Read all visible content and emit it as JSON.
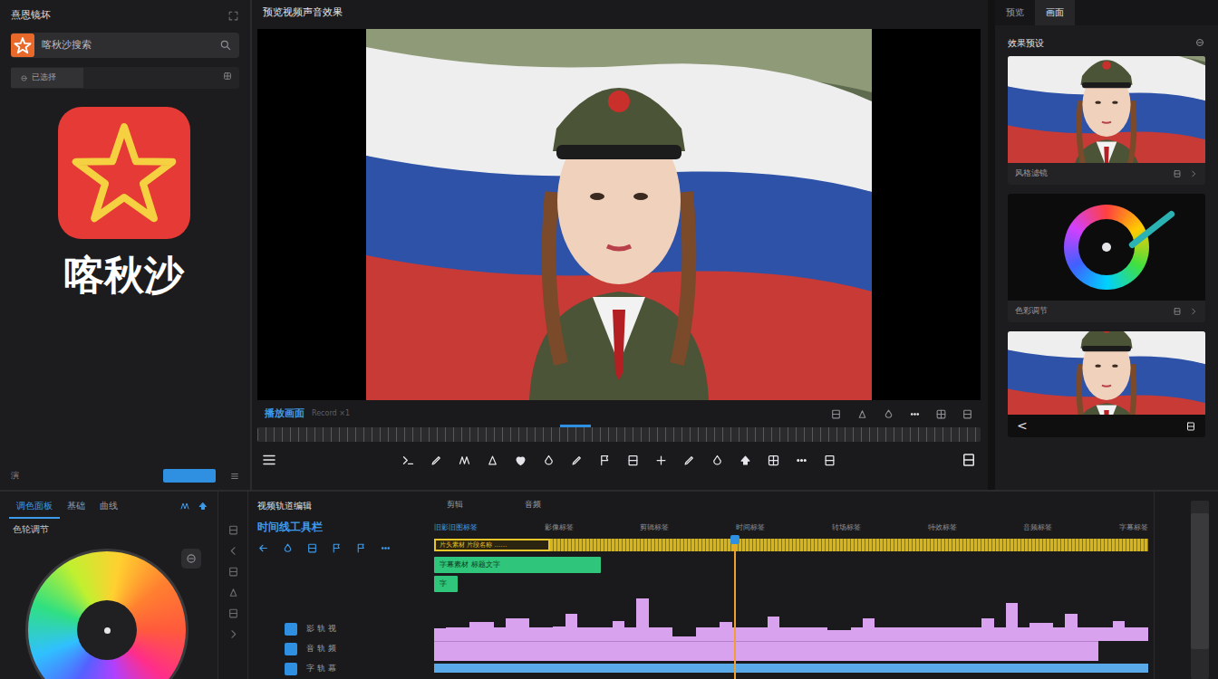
{
  "left_panel": {
    "title": "熹恩镜坏",
    "search": {
      "value": "喀秋沙搜索"
    },
    "filter": {
      "value": "已选择"
    },
    "app": {
      "name": "喀秋沙"
    },
    "footer": {
      "label": "演"
    }
  },
  "preview": {
    "title": "预览视频声音效果",
    "label": "播放画面",
    "timecode": "Record ×1",
    "scrub_level": 0.44
  },
  "right_panel": {
    "tabs": [
      {
        "label": "预览",
        "selected": false
      },
      {
        "label": "画面",
        "selected": true
      }
    ],
    "heading": "效果预设",
    "cards": [
      {
        "kind": "photo",
        "label": "风格滤镜"
      },
      {
        "kind": "wheel",
        "label": "色彩调节"
      },
      {
        "kind": "photo-nav",
        "label": "<"
      }
    ]
  },
  "color_panel": {
    "tabs": [
      {
        "label": "调色面板",
        "selected": true
      },
      {
        "label": "基础",
        "selected": false
      },
      {
        "label": "曲线",
        "selected": false
      }
    ],
    "heading": "色轮调节"
  },
  "timeline": {
    "title": "视频轨道编辑",
    "tabs": [
      {
        "label": "剪辑",
        "selected": false
      },
      {
        "label": "音频",
        "selected": false
      }
    ],
    "toolbar_label": "时间线工具栏",
    "tracks": [
      {
        "name": "影 轨 视"
      },
      {
        "name": "音 轨 频"
      },
      {
        "name": "字 轨 幕"
      }
    ],
    "ruler": [
      "旧影旧图标签",
      "影像标签",
      "剪辑标签",
      "时间标签",
      "转场标签",
      "特效标签",
      "音频标签",
      "字幕标签"
    ],
    "video_clip": {
      "label": "片头素材 片段名称 ……"
    },
    "title_clips": [
      {
        "label": "字幕素材 标题文字"
      },
      {
        "label": "字"
      }
    ],
    "waveform": [
      0.28,
      0.3,
      0.3,
      0.42,
      0.42,
      0.3,
      0.5,
      0.5,
      0.3,
      0.3,
      0.32,
      0.6,
      0.3,
      0.3,
      0.3,
      0.45,
      0.3,
      0.95,
      0.3,
      0.3,
      0.1,
      0.1,
      0.3,
      0.3,
      0.42,
      0.3,
      0.3,
      0.3,
      0.55,
      0.3,
      0.3,
      0.3,
      0.3,
      0.25,
      0.25,
      0.3,
      0.5,
      0.3,
      0.3,
      0.3,
      0.3,
      0.3,
      0.3,
      0.3,
      0.3,
      0.3,
      0.5,
      0.3,
      0.85,
      0.3,
      0.4,
      0.4,
      0.3,
      0.6,
      0.3,
      0.3,
      0.3,
      0.45,
      0.3,
      0.3
    ],
    "audio_clip_level": 0.93,
    "playhead_level": 0.417
  }
}
